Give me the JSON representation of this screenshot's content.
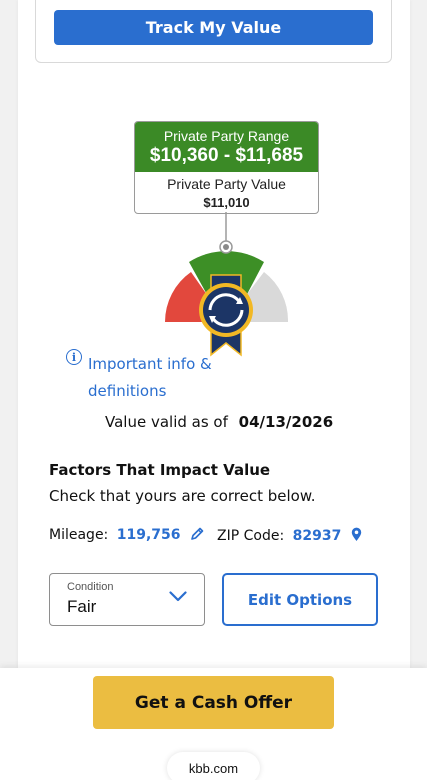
{
  "track": {
    "button_label": "Track My Value"
  },
  "valuation": {
    "range_title": "Private Party Range",
    "range_value": "$10,360 - $11,685",
    "value_title": "Private Party Value",
    "value": "$11,010"
  },
  "gauge": {
    "colors": {
      "left": "#e2483d",
      "middle": "#3d8f26",
      "right": "#d9d9d9",
      "ribbon": "#1c3566",
      "seal_ring": "#f2b824"
    }
  },
  "info": {
    "icon": "info-icon",
    "link_text": "Important info & definitions"
  },
  "validity": {
    "prefix": "Value valid as of",
    "date": "04/13/2026"
  },
  "factors": {
    "title": "Factors That Impact Value",
    "subtitle": "Check that yours are correct below.",
    "mileage_label": "Mileage:",
    "mileage_value": "119,756",
    "zip_label": "ZIP Code:",
    "zip_value": "82937"
  },
  "condition": {
    "label": "Condition",
    "value": "Fair"
  },
  "edit_options": {
    "label": "Edit Options"
  },
  "footer": {
    "cash_offer_label": "Get a Cash Offer",
    "url": "kbb.com"
  },
  "colors": {
    "accent": "#2a6ecf",
    "green": "#3b8a26",
    "cta": "#ebbd41"
  }
}
